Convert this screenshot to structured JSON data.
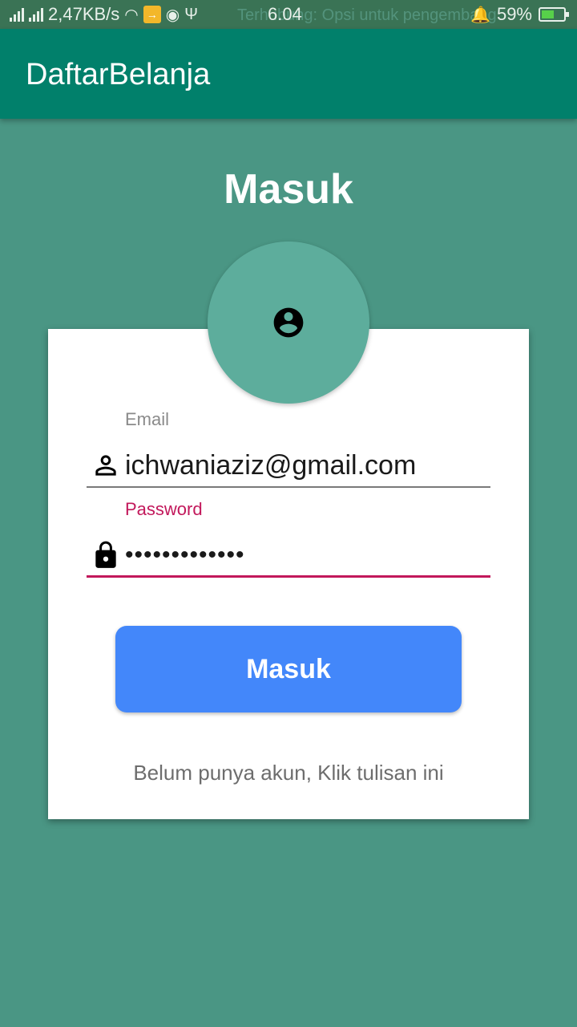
{
  "status_bar": {
    "speed": "2,47KB/s",
    "ticker": "Terhubung: Opsi untuk pengembang",
    "time": "6.04",
    "battery_percent": "59%",
    "battery_level": 0.59
  },
  "app_bar": {
    "title": "DaftarBelanja"
  },
  "page": {
    "title": "Masuk"
  },
  "form": {
    "email_label": "Email",
    "email_value": "ichwaniaziz@gmail.com",
    "password_label": "Password",
    "password_value": "•••••••••••••",
    "submit_label": "Masuk",
    "register_text": "Belum punya akun, Klik tulisan ini"
  },
  "colors": {
    "background": "#4a9684",
    "app_bar": "#01806b",
    "accent": "#c2185b",
    "button": "#4387fa"
  },
  "icons": {
    "avatar": "account-circle-icon",
    "email": "person-icon",
    "password": "lock-icon"
  }
}
